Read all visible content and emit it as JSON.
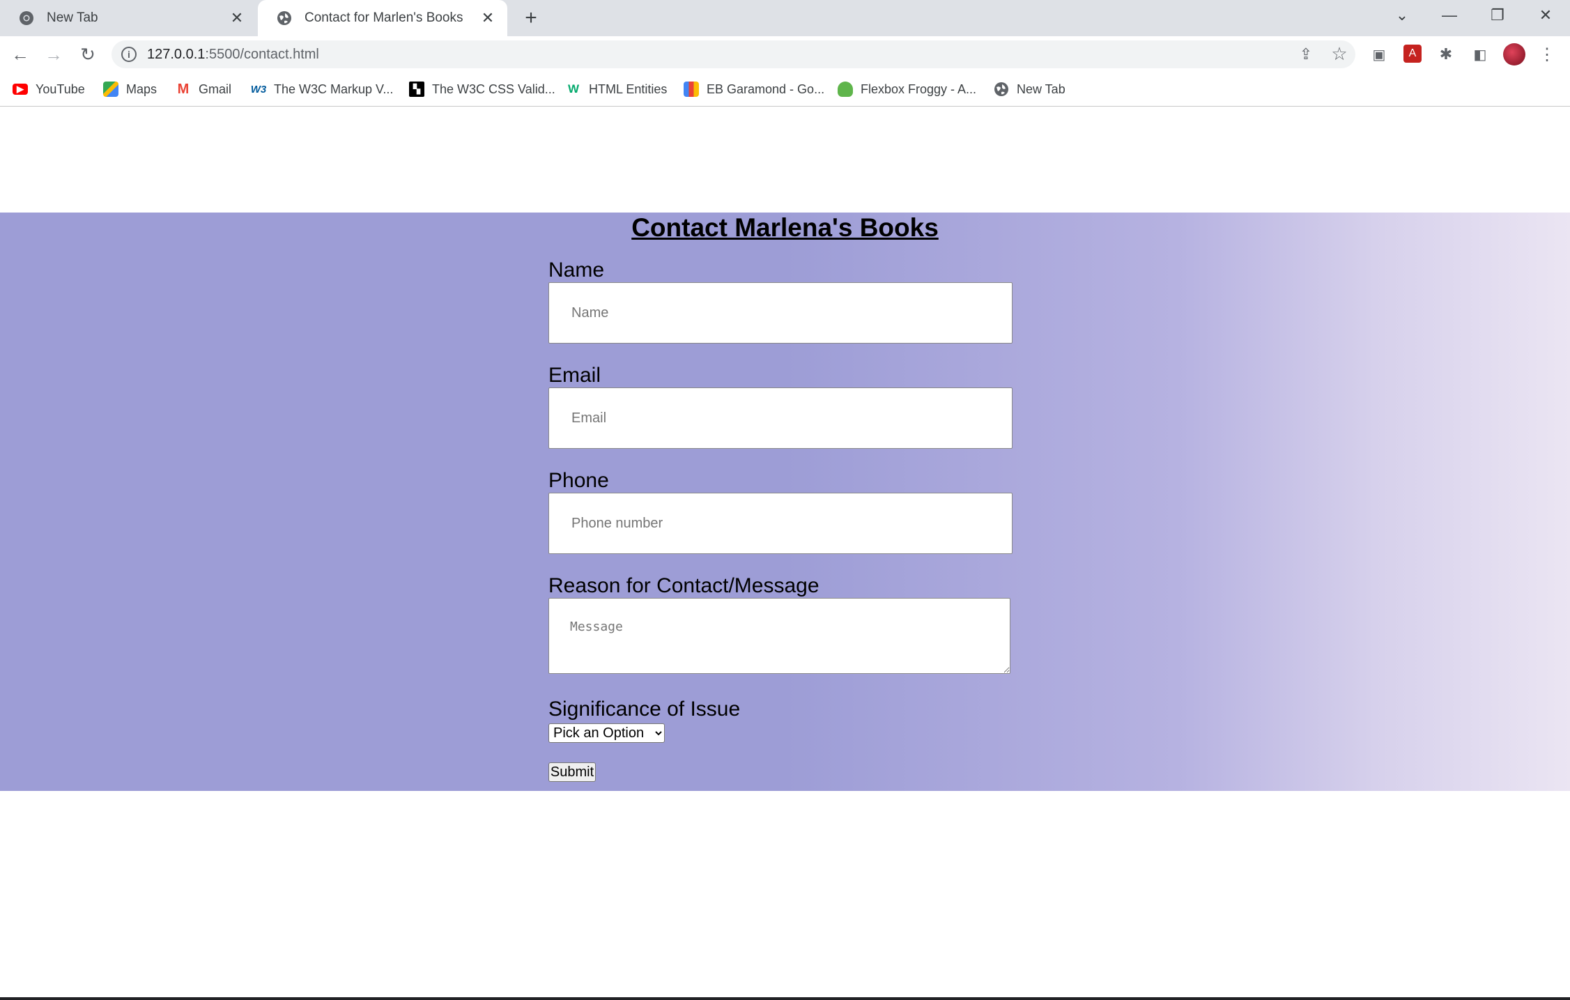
{
  "browser": {
    "tabs": [
      {
        "title": "New Tab",
        "icon": "chrome-icon",
        "active": false
      },
      {
        "title": "Contact for Marlen's Books",
        "icon": "globe-icon",
        "active": true
      }
    ],
    "url_host": "127.0.0.1",
    "url_rest": ":5500/contact.html",
    "bookmarks": [
      {
        "label": "YouTube",
        "icon": "youtube-icon",
        "color": "#ff0000"
      },
      {
        "label": "Maps",
        "icon": "maps-icon",
        "color": "#34a853"
      },
      {
        "label": "Gmail",
        "icon": "gmail-icon",
        "color": "#ea4335"
      },
      {
        "label": "The W3C Markup V...",
        "icon": "w3c-icon",
        "color": "#005a9c"
      },
      {
        "label": "The W3C CSS Valid...",
        "icon": "w3c-css-icon",
        "color": "#000000"
      },
      {
        "label": "HTML Entities",
        "icon": "w3schools-icon",
        "color": "#04aa6d"
      },
      {
        "label": "EB Garamond - Go...",
        "icon": "google-fonts-icon",
        "color": "#4285f4"
      },
      {
        "label": "Flexbox Froggy - A...",
        "icon": "froggy-icon",
        "color": "#5fb54b"
      },
      {
        "label": "New Tab",
        "icon": "globe-icon",
        "color": "#5f6368"
      }
    ]
  },
  "page": {
    "title": "Contact Marlena's Books",
    "name_label": "Name",
    "name_placeholder": "Name",
    "email_label": "Email",
    "email_placeholder": "Email",
    "phone_label": "Phone",
    "phone_placeholder": "Phone number",
    "message_label": "Reason for Contact/Message",
    "message_placeholder": "Message",
    "significance_label": "Significance of Issue",
    "significance_selected": "Pick an Option",
    "submit_label": "Submit"
  },
  "colors": {
    "gradient_start": "#9d9dd6",
    "gradient_end": "#ebe5f3"
  }
}
